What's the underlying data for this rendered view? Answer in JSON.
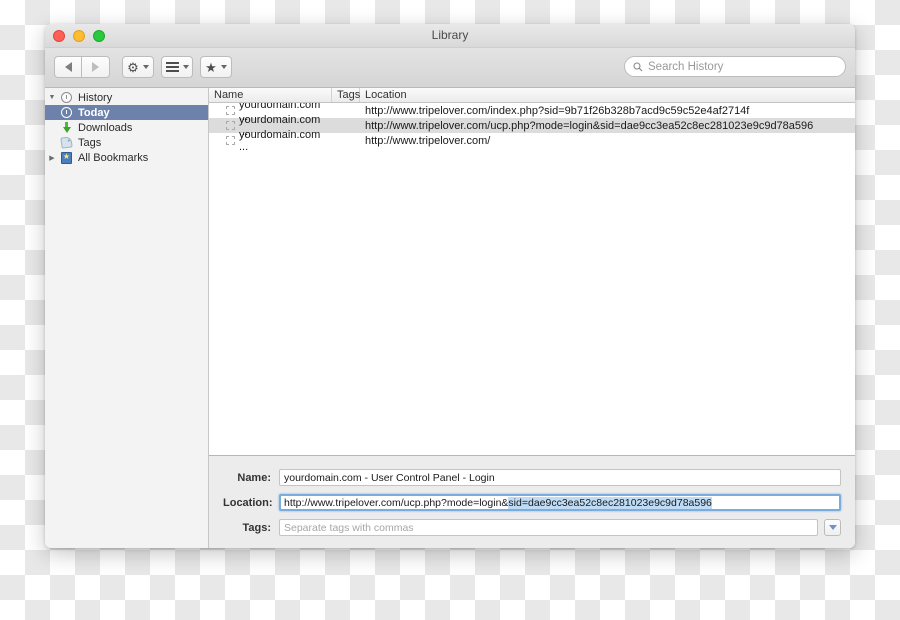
{
  "window": {
    "title": "Library",
    "traffic_lights": [
      "close",
      "minimize",
      "zoom"
    ]
  },
  "toolbar": {
    "back_icon": "back-arrow-icon",
    "forward_icon": "forward-arrow-icon",
    "gear_icon": "gear-icon",
    "list_icon": "list-view-icon",
    "bookmark_icon": "bookmark-star-icon",
    "search": {
      "icon": "search-icon",
      "placeholder": "Search History",
      "value": ""
    }
  },
  "sidebar": {
    "items": [
      {
        "label": "History",
        "icon": "clock-icon",
        "level": 0,
        "disclosure": "expanded",
        "selected": false
      },
      {
        "label": "Today",
        "icon": "clock-icon",
        "level": 1,
        "disclosure": "none",
        "selected": true
      },
      {
        "label": "Downloads",
        "icon": "download-icon",
        "level": 1,
        "disclosure": "none",
        "selected": false
      },
      {
        "label": "Tags",
        "icon": "tag-icon",
        "level": 1,
        "disclosure": "none",
        "selected": false
      },
      {
        "label": "All Bookmarks",
        "icon": "book-icon",
        "level": 0,
        "disclosure": "collapsed",
        "selected": false
      }
    ]
  },
  "list": {
    "columns": [
      "Name",
      "Tags",
      "Location"
    ],
    "rows": [
      {
        "name": "yourdomain.com ...",
        "tags": "",
        "location": "http://www.tripelover.com/index.php?sid=9b71f26b328b7acd9c59c52e4af2714f",
        "selected": false
      },
      {
        "name": "yourdomain.com ...",
        "tags": "",
        "location": "http://www.tripelover.com/ucp.php?mode=login&sid=dae9cc3ea52c8ec281023e9c9d78a596",
        "selected": true
      },
      {
        "name": "yourdomain.com ...",
        "tags": "",
        "location": "http://www.tripelover.com/",
        "selected": false
      }
    ]
  },
  "detail": {
    "name_label": "Name:",
    "name_value": "yourdomain.com - User Control Panel - Login",
    "location_label": "Location:",
    "location_value_prefix": "http://www.tripelover.com/ucp.php?mode=login&",
    "location_value_selected": "sid=dae9cc3ea52c8ec281023e9c9d78a596",
    "tags_label": "Tags:",
    "tags_value": "",
    "tags_placeholder": "Separate tags with commas",
    "tags_dropdown_icon": "chevron-down-icon"
  },
  "colors": {
    "selection_blue": "#6d82ab",
    "text_highlight": "#bfdcf7",
    "focus_ring": "#7aadde"
  }
}
